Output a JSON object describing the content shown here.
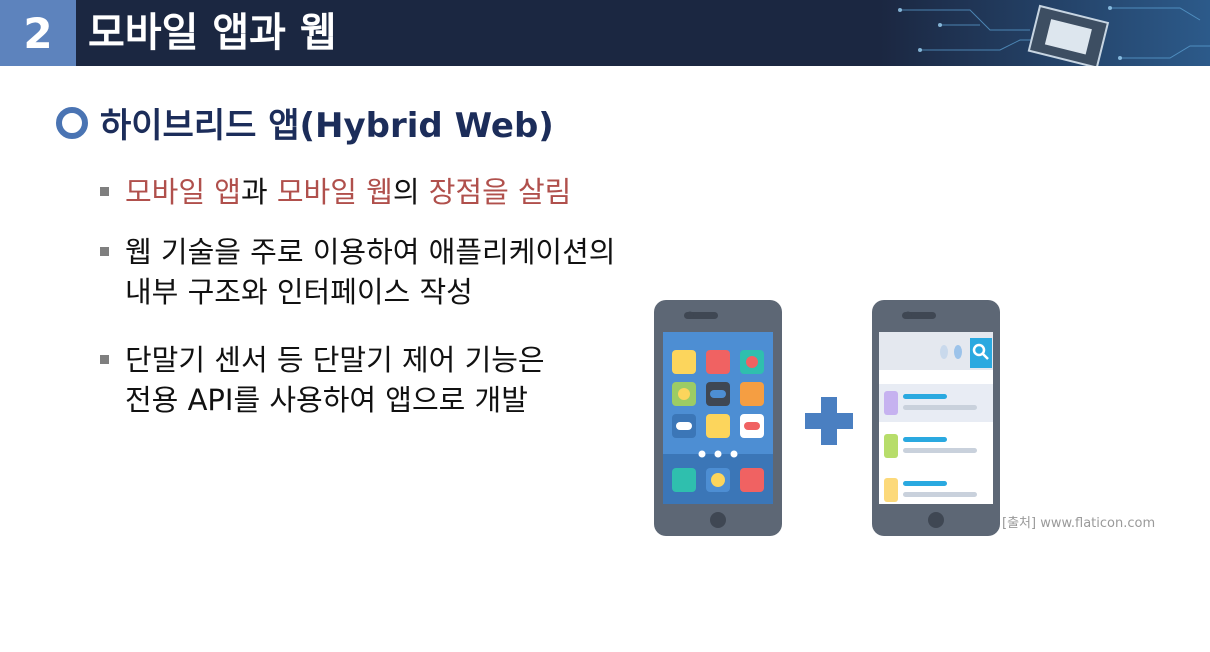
{
  "header": {
    "number": "2",
    "title": "모바일 앱과 웹"
  },
  "heading": "하이브리드 앱(Hybrid Web)",
  "bullets": {
    "b1": {
      "part1": "모바일 앱",
      "part2": "과 ",
      "part3": "모바일 웹",
      "part4": "의 ",
      "part5": "장점을 살림"
    },
    "b2": {
      "line1": "웹 기술을 주로 이용하여 애플리케이션의",
      "line2": "내부 구조와 인터페이스 작성"
    },
    "b3": {
      "line1": "단말기 센서 등 단말기 제어 기능은",
      "line2": "전용 API를 사용하여 앱으로 개발"
    }
  },
  "credit": "[출처] www.flaticon.com",
  "colors": {
    "header_bg": "#1b2741",
    "number_bg": "#5d83bd",
    "heading": "#1c2d5a",
    "highlight": "#b0504c",
    "plus": "#4a7fc1"
  }
}
